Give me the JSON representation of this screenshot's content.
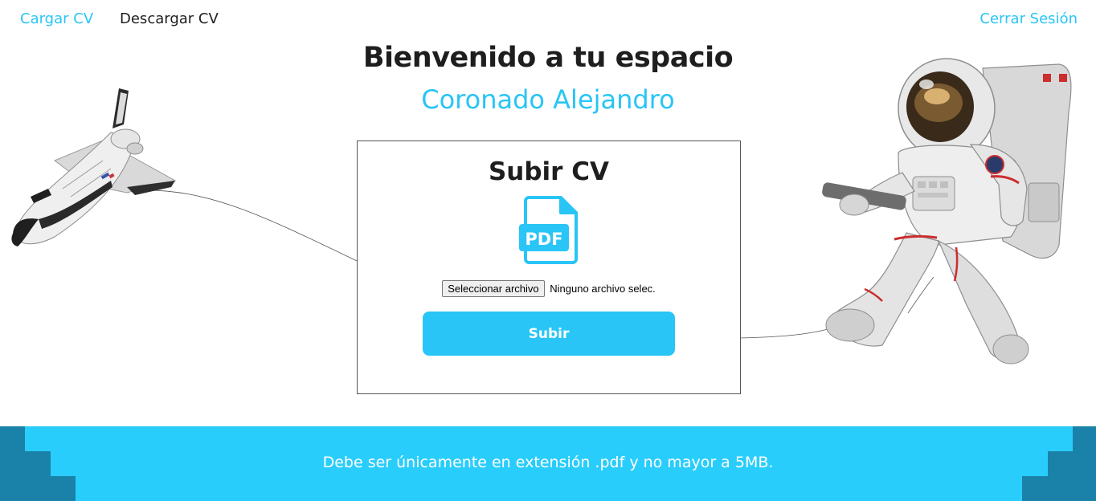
{
  "nav": {
    "upload_label": "Cargar CV",
    "download_label": "Descargar CV",
    "logout_label": "Cerrar Sesión"
  },
  "welcome": {
    "title": "Bienvenido a tu espacio",
    "user_name": "Coronado Alejandro"
  },
  "upload": {
    "title": "Subir CV",
    "icon": "pdf-file-icon",
    "icon_text": "PDF",
    "file_button_label": "Seleccionar archivo",
    "file_status": "Ninguno archivo selec.",
    "submit_label": "Subir"
  },
  "footer": {
    "note": "Debe ser únicamente en extensión .pdf y no mayor a 5MB."
  },
  "colors": {
    "accent": "#29c5f6",
    "footer_bg": "#29cdfc",
    "footer_dark": "#1a82a8",
    "text": "#1e1e1e"
  }
}
